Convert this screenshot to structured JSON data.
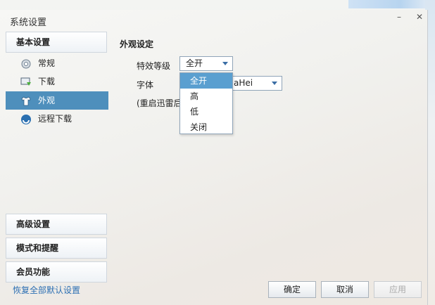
{
  "window": {
    "title": "系统设置",
    "min_glyph": "–",
    "close_glyph": "✕"
  },
  "sidebar": {
    "basic_header": "基本设置",
    "items": [
      {
        "label": "常规",
        "icon": "gear-icon"
      },
      {
        "label": "下载",
        "icon": "download-icon"
      },
      {
        "label": "外观",
        "icon": "shirt-icon",
        "selected": true
      },
      {
        "label": "远程下载",
        "icon": "remote-download-icon"
      }
    ],
    "advanced_header": "高级设置",
    "mode_header": "模式和提醒",
    "member_header": "会员功能"
  },
  "main": {
    "section_title": "外观设定",
    "effect_label": "特效等级",
    "effect_value": "全开",
    "font_label": "字体",
    "font_value": "aHei",
    "restart_note": "(重启迅雷后",
    "effect_options": [
      "全开",
      "高",
      "低",
      "关闭"
    ]
  },
  "footer": {
    "reset_link": "恢复全部默认设置",
    "ok": "确定",
    "cancel": "取消",
    "apply": "应用"
  },
  "colors": {
    "selected": "#4e8fbc",
    "dropdown_highlight": "#5a9fd0",
    "link": "#2c6fb3"
  }
}
